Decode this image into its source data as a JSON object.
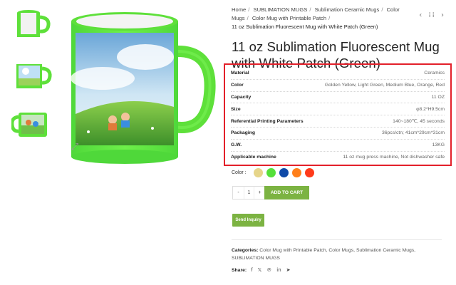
{
  "breadcrumb": {
    "items": [
      "Home",
      "SUBLIMATION MUGS",
      "Sublimation Ceramic Mugs",
      "Color Mugs",
      "Color Mug with Printable Patch"
    ],
    "current": "11 oz Sublimation Fluorescent Mug with White Patch (Green)"
  },
  "nav": {
    "prev": "‹",
    "grid": "⁞⁞",
    "next": "›"
  },
  "product": {
    "title": "11 oz Sublimation Fluorescent Mug with White Patch (Green)"
  },
  "specs": [
    {
      "label": "Material",
      "value": "Ceramics"
    },
    {
      "label": "Color",
      "value": "Golden Yellow, Light Green, Medium Blue, Orange, Red"
    },
    {
      "label": "Capacity",
      "value": "11 OZ"
    },
    {
      "label": "Size",
      "value": "φ8.2*H9.5cm"
    },
    {
      "label": "Referential Printing Parameters",
      "value": "140~180℃, 45 seconds"
    },
    {
      "label": "Packaging",
      "value": "36pcs/ctn; 41cm*29cm*31cm"
    },
    {
      "label": "G.W.",
      "value": "13KG"
    },
    {
      "label": "Applicable machine",
      "value": "11 oz mug press machine, Not dishwasher safe"
    }
  ],
  "color_selector": {
    "label": "Color :",
    "swatches": [
      {
        "name": "golden-yellow",
        "hex": "#e6d58a"
      },
      {
        "name": "light-green",
        "hex": "#55e03a"
      },
      {
        "name": "medium-blue",
        "hex": "#0f4aa8"
      },
      {
        "name": "orange",
        "hex": "#ff7f1a"
      },
      {
        "name": "red",
        "hex": "#ff3a1a"
      }
    ]
  },
  "quantity": {
    "minus": "-",
    "value": "1",
    "plus": "+"
  },
  "buttons": {
    "add_to_cart": "ADD TO CART",
    "send_inquiry": "Send Inquiry"
  },
  "categories": {
    "label": "Categories:",
    "items": [
      "Color Mug with Printable Patch",
      "Color Mugs",
      "Sublimation Ceramic Mugs",
      "SUBLIMATION MUGS"
    ]
  },
  "share": {
    "label": "Share:",
    "icons": [
      "facebook-icon",
      "twitter-icon",
      "pinterest-icon",
      "linkedin-icon",
      "telegram-icon"
    ],
    "glyphs": [
      "f",
      "𝕏",
      "℗",
      "in",
      "➤"
    ]
  },
  "colors": {
    "accent": "#7cb342",
    "highlight": "#e3202a",
    "mug_green": "#5ee03a"
  }
}
